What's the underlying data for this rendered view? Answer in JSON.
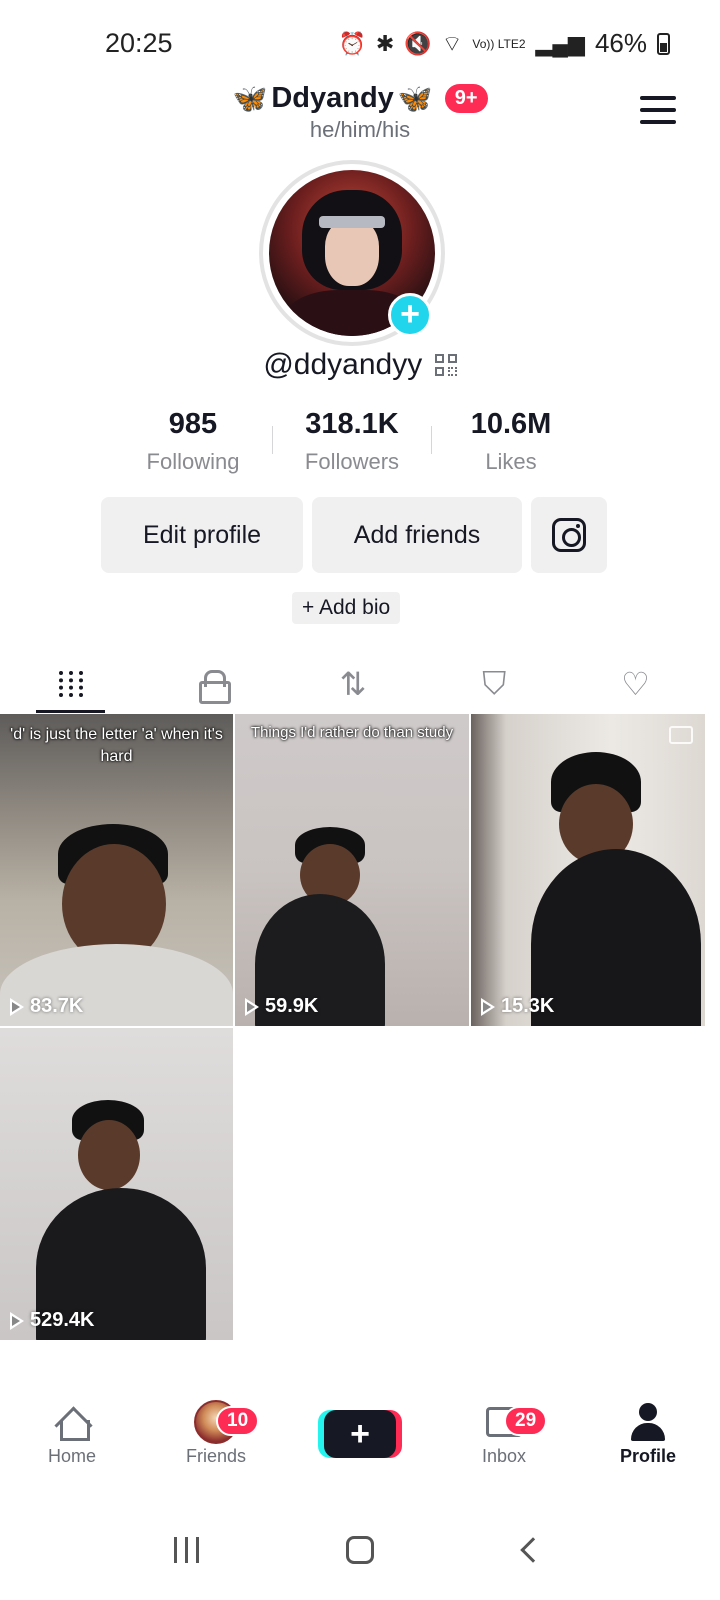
{
  "status_bar": {
    "time": "20:25",
    "battery": "46%",
    "network": "Vo)) LTE2",
    "icons": [
      "alarm-icon",
      "bluetooth-icon",
      "mute-icon",
      "wifi-icon",
      "signal-icon",
      "battery-icon"
    ]
  },
  "header": {
    "display_name": "Ddyandy",
    "notification_badge": "9+",
    "pronouns": "he/him/his"
  },
  "profile": {
    "username": "@ddyandyy",
    "stats": [
      {
        "value": "985",
        "label": "Following"
      },
      {
        "value": "318.1K",
        "label": "Followers"
      },
      {
        "value": "10.6M",
        "label": "Likes"
      }
    ],
    "buttons": {
      "edit": "Edit profile",
      "add_friends": "Add friends"
    },
    "add_bio": "+ Add bio"
  },
  "tabs": [
    "videos-grid-icon",
    "private-lock-icon",
    "reposts-icon",
    "favorites-icon",
    "liked-icon"
  ],
  "videos": [
    {
      "caption": "'d' is just the letter 'a' when it's hard",
      "views": "83.7K"
    },
    {
      "caption": "Things I'd rather do than study",
      "views": "59.9K"
    },
    {
      "caption": "",
      "views": "15.3K"
    },
    {
      "caption": "",
      "views": "529.4K"
    }
  ],
  "bottom_nav": {
    "home": "Home",
    "friends": "Friends",
    "friends_badge": "10",
    "inbox": "Inbox",
    "inbox_badge": "29",
    "profile": "Profile"
  },
  "colors": {
    "accent_red": "#fe2c55",
    "accent_cyan": "#25f4ee",
    "text_primary": "#161823",
    "text_secondary": "#8a8b91"
  }
}
